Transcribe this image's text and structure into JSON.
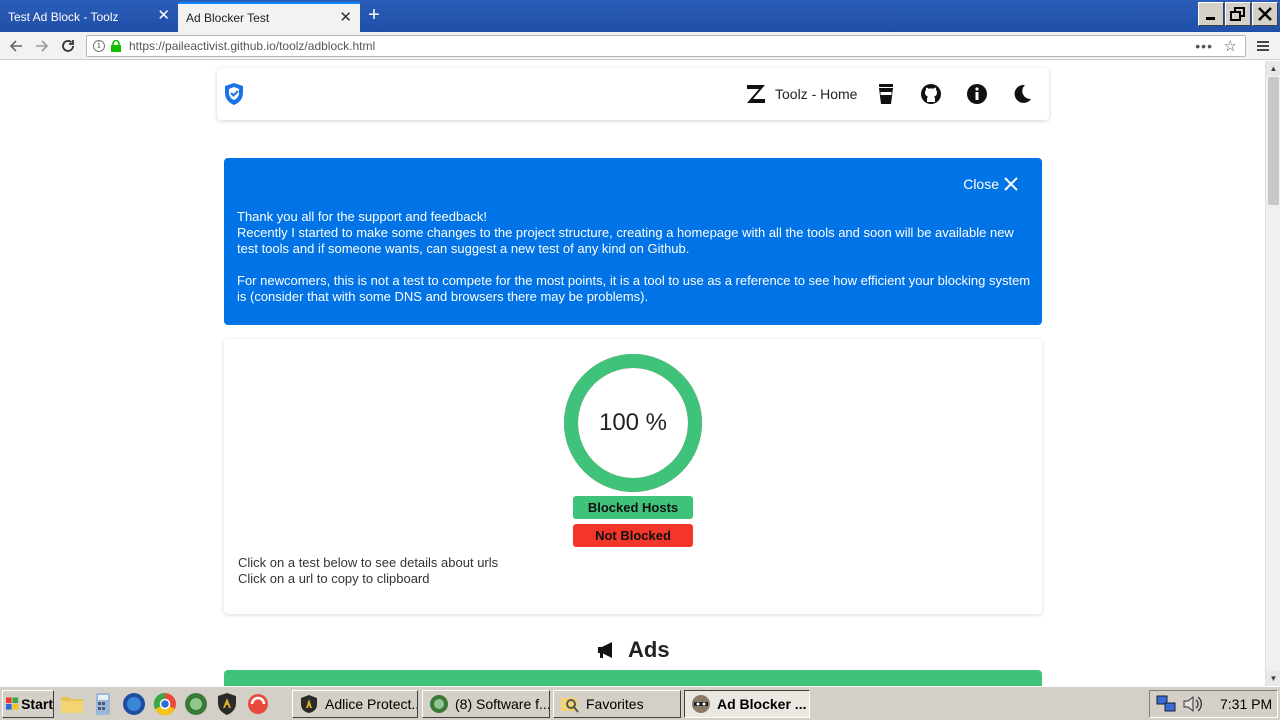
{
  "browser": {
    "tabs": [
      {
        "label": "Test Ad Block - Toolz",
        "active": false
      },
      {
        "label": "Ad Blocker Test",
        "active": true
      }
    ],
    "url": "https://paileactivist.github.io/toolz/adblock.html"
  },
  "header": {
    "home_label": "Toolz - Home"
  },
  "alert": {
    "close_label": "Close",
    "lines": [
      "Thank you all for the support and feedback!",
      "Recently I started to make some changes to the project structure, creating a homepage with all the tools and soon will be available new test tools and if someone wants, can suggest a new test of any kind on Github.",
      "For newcomers, this is not a test to compete for the most points, it is a tool to use as a reference to see how efficient your blocking system is (consider that with some DNS and browsers there may be problems)."
    ]
  },
  "score": {
    "percent_label": "100 %",
    "blocked_fraction": 1.0,
    "colors": {
      "blocked": "#3fc37b",
      "not_blocked": "#f4362a"
    },
    "legend": {
      "blocked": "Blocked Hosts",
      "not_blocked": "Not Blocked"
    },
    "hints": [
      "Click on a test below to see details about urls",
      "Click on a url to copy to clipboard"
    ]
  },
  "sections": [
    {
      "title": "Ads",
      "icon": "megaphone-icon"
    }
  ],
  "taskbar": {
    "start_label": "Start",
    "tasks": [
      {
        "label": "Adlice Protect...",
        "active": false
      },
      {
        "label": "(8) Software f...",
        "active": false
      },
      {
        "label": "Favorites",
        "active": false
      },
      {
        "label": "Ad Blocker ...",
        "active": true
      }
    ],
    "clock": "7:31 PM"
  },
  "theme": {
    "accent": "#0073e6",
    "green": "#3fc37b",
    "red": "#f4362a"
  }
}
